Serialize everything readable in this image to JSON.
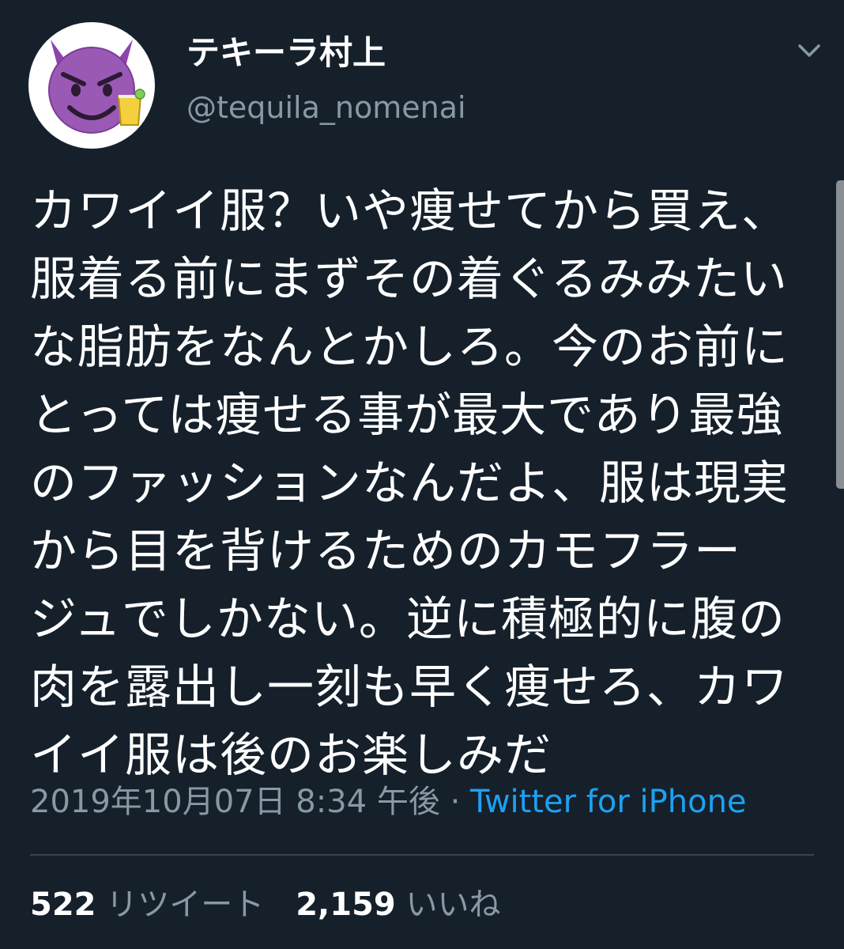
{
  "colors": {
    "background": "#15202b",
    "primary_text": "#ffffff",
    "secondary_text": "#8899a6",
    "link": "#1da1f2",
    "divider": "#38444d"
  },
  "user": {
    "display_name": "テキーラ村上",
    "handle": "@tequila_nomenai",
    "avatar_icon": "smiling-devil-with-tequila-glass-icon"
  },
  "tweet": {
    "lines": [
      "カワイイ服？いや痩せてから買え、",
      "服着る前にまずその着ぐるみみたい",
      "な脂肪をなんとかしろ。今のお前に",
      "とっては痩せる事が最大であり最強",
      "のファッションなんだよ、服は現実",
      "から目を背けるためのカモフラー",
      "ジュでしかない。逆に積極的に腹の",
      "肉を露出し一刻も早く痩せろ、カワ",
      "イイ服は後のお楽しみだ"
    ]
  },
  "meta": {
    "timestamp": "2019年10月07日 8:34 午後",
    "separator": " · ",
    "source": "Twitter for iPhone"
  },
  "stats": {
    "retweets_count": "522",
    "retweets_label": "リツイート",
    "likes_count": "2,159",
    "likes_label": "いいね"
  }
}
